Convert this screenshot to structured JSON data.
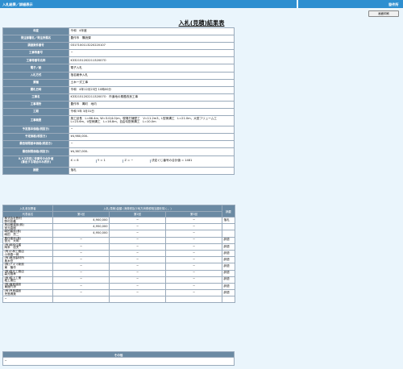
{
  "topbar": {
    "breadcrumb": "入札結果／詳細表示",
    "right_label": "發件所"
  },
  "print_button": "画面印刷",
  "title": "入札(見積)結果表",
  "info": [
    {
      "label": "年度",
      "value": "令和　4年度"
    },
    {
      "label": "発注部署名／発注所属名",
      "value": "豊作市　購読課"
    },
    {
      "label": "調達案件番号",
      "value": "0317100113220220107"
    },
    {
      "label": "工事等番号",
      "value": "−"
    },
    {
      "label": "工事等番号名称",
      "value": "K33215120221132007O"
    },
    {
      "label": "電子／紙",
      "value": "電子入札"
    },
    {
      "label": "入札方式",
      "value": "指名競争入札"
    },
    {
      "label": "業種",
      "value": "土木一式工事"
    },
    {
      "label": "開札日時",
      "value": "令和　4年12月23日 10時00分"
    },
    {
      "label": "工事名",
      "value": "K33215120221132007O　市道地の素鑑改良工事"
    },
    {
      "label": "工事場所",
      "value": "豊作市　萬町　地内"
    },
    {
      "label": "工期",
      "value": "令和 5年 3月31日"
    },
    {
      "label": "工事概要",
      "value": "施工延長　L=86.4m, W=3.0(4.0)m，現場打擁壁工　V=11.2m3，L型側溝工　L=21.0m，大型フリューム工　L=23.6m，U型側溝工　L=16.8m，自由勾配側溝工　L=10.0m"
    },
    {
      "label": "予定基本価格(税抜き)",
      "value": "−"
    },
    {
      "label": "予定価格(税抜き)",
      "value": "¥4,980,000-"
    },
    {
      "label": "最低制限基本価格(税抜き)",
      "value": "−"
    },
    {
      "label": "最低制限価格(税抜き)",
      "value": "¥4,387,000-"
    }
  ],
  "xyz": {
    "label": "X,Y,Z決定に伴番号の合計値\n(算出する場合のみ表示)",
    "x": "X = 8",
    "y": "Y = 1",
    "z": "Z = −",
    "note": "決定ぐじ番号の合計値 = 1481"
  },
  "remarks": {
    "label": "摘要",
    "value": "落札"
  },
  "bids": {
    "headers": {
      "bidder": "入札参加業者",
      "amounts": "入札(見積)金額 (消費税及び地方消費税相当額を除く。)",
      "remarks": "摘要",
      "rep": "代表者名",
      "r1": "第1回",
      "r2": "第2回",
      "r3": "第3回"
    },
    "rows": [
      {
        "name": "株式会社野村\n野村忠義",
        "r1": "4,900,000",
        "r2": "−",
        "r3": "−",
        "remark": "落札"
      },
      {
        "name": "鳥加樹建設(株)\n宮元直樹",
        "r1": "4,950,000",
        "r2": "−",
        "r3": "−",
        "remark": ""
      },
      {
        "name": "嶋田建設(株)\n嶋田　貢二",
        "r1": "4,950,000",
        "r2": "−",
        "r3": "−",
        "remark": ""
      },
      {
        "name": "豊作建設(株)\n宮元　大明",
        "r1": "−",
        "r2": "−",
        "r3": "−",
        "remark": "辞退"
      },
      {
        "name": "(有)岡本住建\n岡本　信夫",
        "r1": "−",
        "r2": "−",
        "r3": "−",
        "remark": "辞退"
      },
      {
        "name": "(有)小林工務店\n小林春一郎",
        "r1": "−",
        "r2": "−",
        "r3": "−",
        "remark": "辞退"
      },
      {
        "name": "(有)奥田製材所\n奥木岳",
        "r1": "−",
        "r2": "−",
        "r3": "−",
        "remark": "辞退"
      },
      {
        "name": "(株)アズマ新設\n東　隆作",
        "r1": "−",
        "r2": "−",
        "r3": "−",
        "remark": "辞退"
      },
      {
        "name": "(株)森元工務店\n森元推孝",
        "r1": "−",
        "r2": "−",
        "r3": "−",
        "remark": "辞退"
      },
      {
        "name": "(有)堀上工業\n堀上朋広",
        "r1": "−",
        "r2": "−",
        "r3": "−",
        "remark": "辞退"
      },
      {
        "name": "(株)東館建設\n東館竹涼",
        "r1": "−",
        "r2": "−",
        "r3": "−",
        "remark": "辞退"
      },
      {
        "name": "(有)児島建設\n児島博美",
        "r1": "−",
        "r2": "−",
        "r3": "−",
        "remark": "辞退"
      },
      {
        "name": "−",
        "r1": "",
        "r2": "",
        "r3": "",
        "remark": ""
      }
    ]
  },
  "other": {
    "label": "その他",
    "value": "−"
  }
}
